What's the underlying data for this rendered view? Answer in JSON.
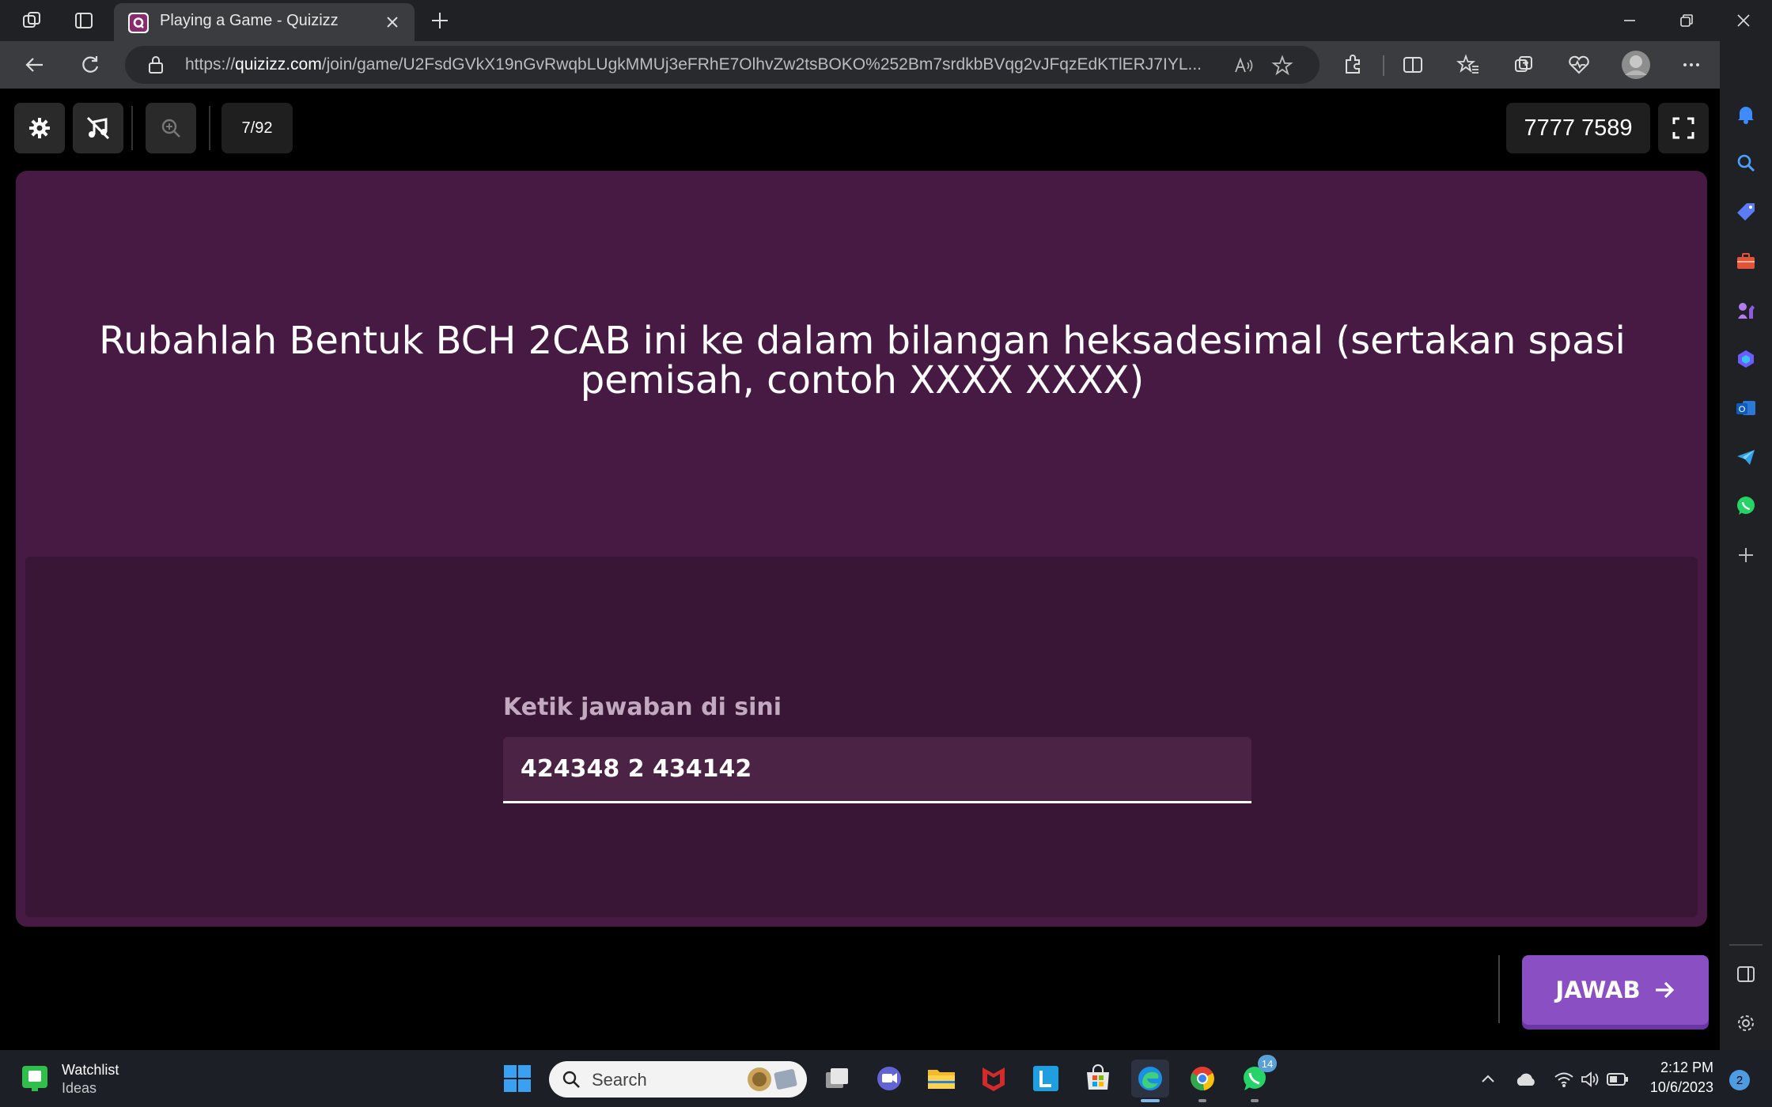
{
  "browser": {
    "tab_title": "Playing a Game - Quizizz",
    "url_prefix": "https://",
    "url_domain": "quizizz.com",
    "url_path": "/join/game/U2FsdGVkX19nGvRwqbLUgkMMUj3eFRhE7OlhvZw2tsBOKO%252Bm7srdkbBVqg2vJFqzEdKTlERJ7IYL..."
  },
  "quiz": {
    "question_counter": "7/92",
    "game_code": "7777 7589",
    "question": "Rubahlah Bentuk BCH 2CAB ini ke dalam bilangan heksadesimal (sertakan spasi pemisah, contoh XXXX XXXX)",
    "answer_label": "Ketik jawaban di sini",
    "answer_value": "424348 2 434142",
    "submit_label": "JAWAB"
  },
  "taskbar": {
    "widget_title": "Watchlist",
    "widget_subtitle": "Ideas",
    "search_placeholder": "Search",
    "whatsapp_badge": "14",
    "time": "2:12 PM",
    "date": "10/6/2023",
    "notification_count": "2"
  },
  "colors": {
    "card": "#461a43",
    "answer_area": "#391635",
    "submit": "#8a4fc3"
  }
}
